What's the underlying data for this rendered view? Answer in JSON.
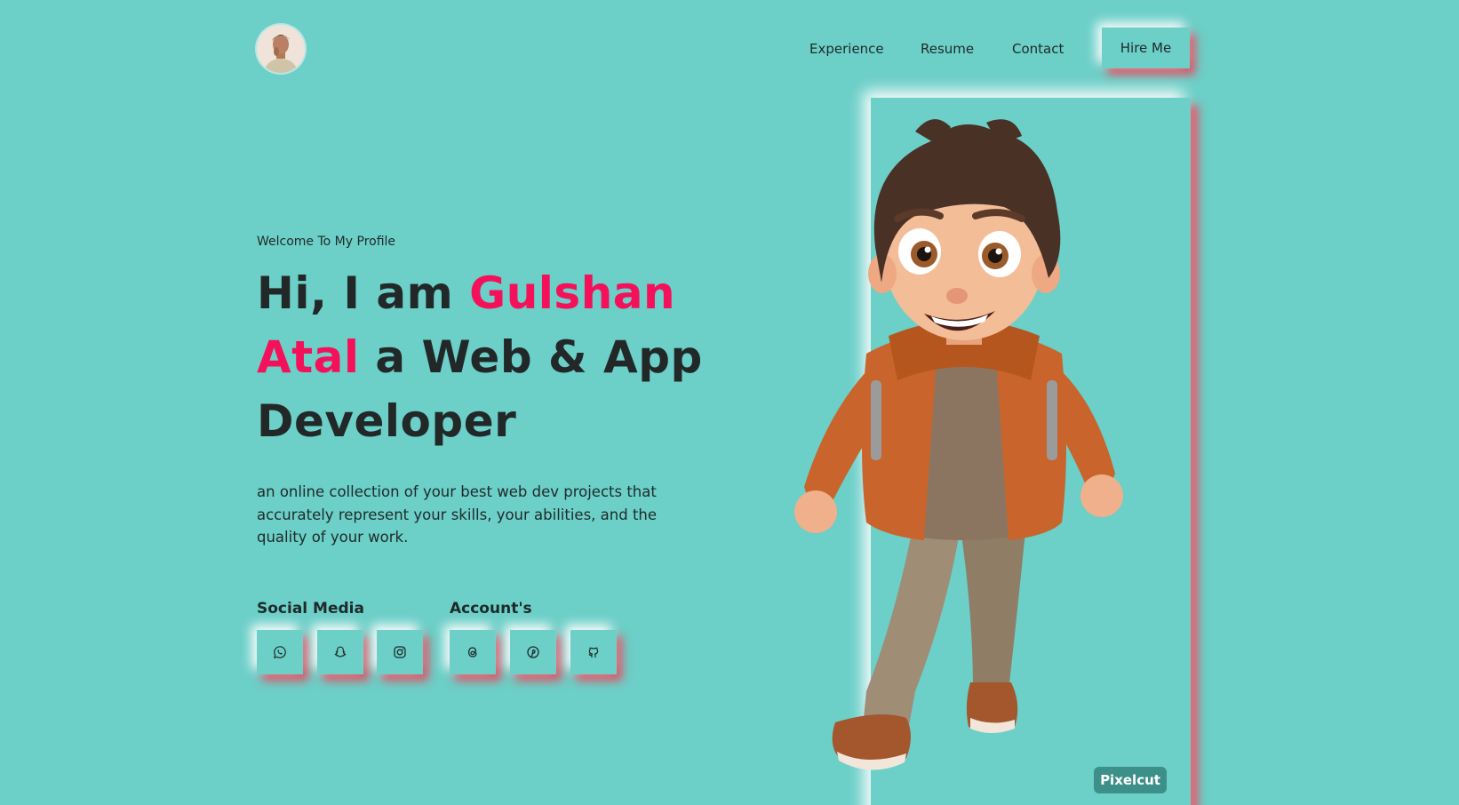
{
  "header": {
    "nav": [
      "Experience",
      "Resume",
      "Contact"
    ],
    "hire_label": "Hire Me"
  },
  "hero": {
    "welcome": "Welcome To My Profile",
    "headline_part1": "Hi, I am ",
    "headline_name": "Gulshan Atal",
    "headline_part2": " a Web & App Developer",
    "description": "an online collection of your best web dev projects that accurately represent your skills, your abilities, and the quality of your work."
  },
  "social": {
    "title": "Social Media",
    "icons": [
      "whatsapp-icon",
      "snapchat-icon",
      "instagram-icon"
    ]
  },
  "accounts": {
    "title": "Account's",
    "icons": [
      "threads-icon",
      "pinterest-icon",
      "github-icon"
    ]
  },
  "watermark": "Pixelcut",
  "colors": {
    "background": "#6ccfc8",
    "accent": "#f4115a",
    "shadow": "#e8485c"
  }
}
